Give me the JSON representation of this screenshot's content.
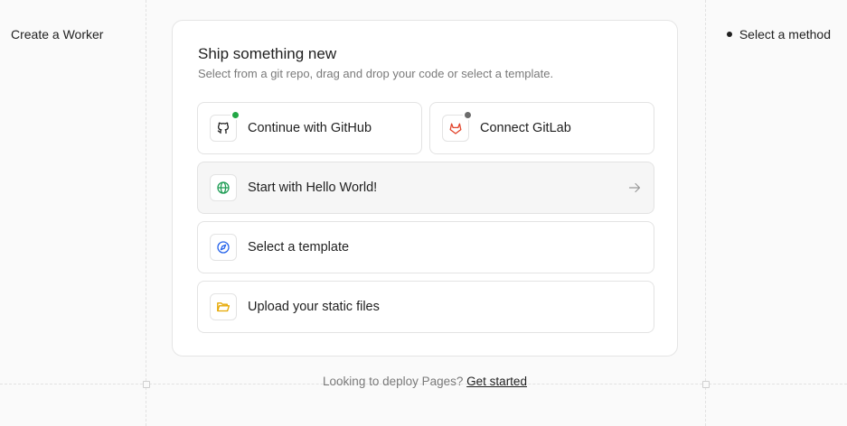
{
  "left": {
    "title": "Create a Worker"
  },
  "right": {
    "step_label": "Select a method"
  },
  "card": {
    "title": "Ship something new",
    "subtitle": "Select from a git repo, drag and drop your code or select a template.",
    "options": {
      "github": {
        "label": "Continue with GitHub",
        "icon": "github-icon",
        "status_color": "#22a745"
      },
      "gitlab": {
        "label": "Connect GitLab",
        "icon": "gitlab-icon",
        "status_color": "#6b6b6b"
      },
      "hello": {
        "label": "Start with Hello World!",
        "icon": "globe-icon"
      },
      "template": {
        "label": "Select a template",
        "icon": "compass-icon"
      },
      "upload": {
        "label": "Upload your static files",
        "icon": "folder-icon"
      }
    }
  },
  "footer": {
    "text": "Looking to deploy Pages?",
    "link": "Get started"
  },
  "colors": {
    "github_status": "#22a745",
    "gitlab_status": "#6b6b6b",
    "gitlab_brand": "#e2432a",
    "globe": "#1f9d55",
    "compass": "#2563eb",
    "folder": "#e6a700"
  }
}
